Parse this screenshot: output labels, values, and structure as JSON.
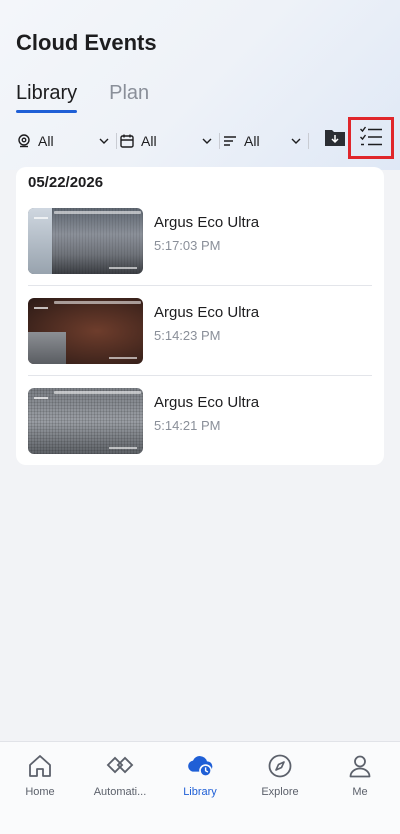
{
  "header": {
    "title": "Cloud Events"
  },
  "tabs": [
    {
      "label": "Library",
      "active": true
    },
    {
      "label": "Plan",
      "active": false
    }
  ],
  "filters": {
    "location": "All",
    "date": "All",
    "type": "All"
  },
  "content": {
    "date_label": "05/22/2026",
    "events": [
      {
        "camera": "Argus Eco Ultra",
        "time": "5:17:03 PM"
      },
      {
        "camera": "Argus Eco Ultra",
        "time": "5:14:23 PM"
      },
      {
        "camera": "Argus Eco Ultra",
        "time": "5:14:21 PM"
      }
    ]
  },
  "nav": [
    {
      "label": "Home",
      "icon": "home-icon"
    },
    {
      "label": "Automati...",
      "icon": "automation-icon"
    },
    {
      "label": "Library",
      "icon": "cloud-library-icon",
      "active": true
    },
    {
      "label": "Explore",
      "icon": "compass-icon"
    },
    {
      "label": "Me",
      "icon": "person-icon"
    }
  ],
  "colors": {
    "accent": "#1f5fd6",
    "highlight_box": "#e0262b"
  }
}
